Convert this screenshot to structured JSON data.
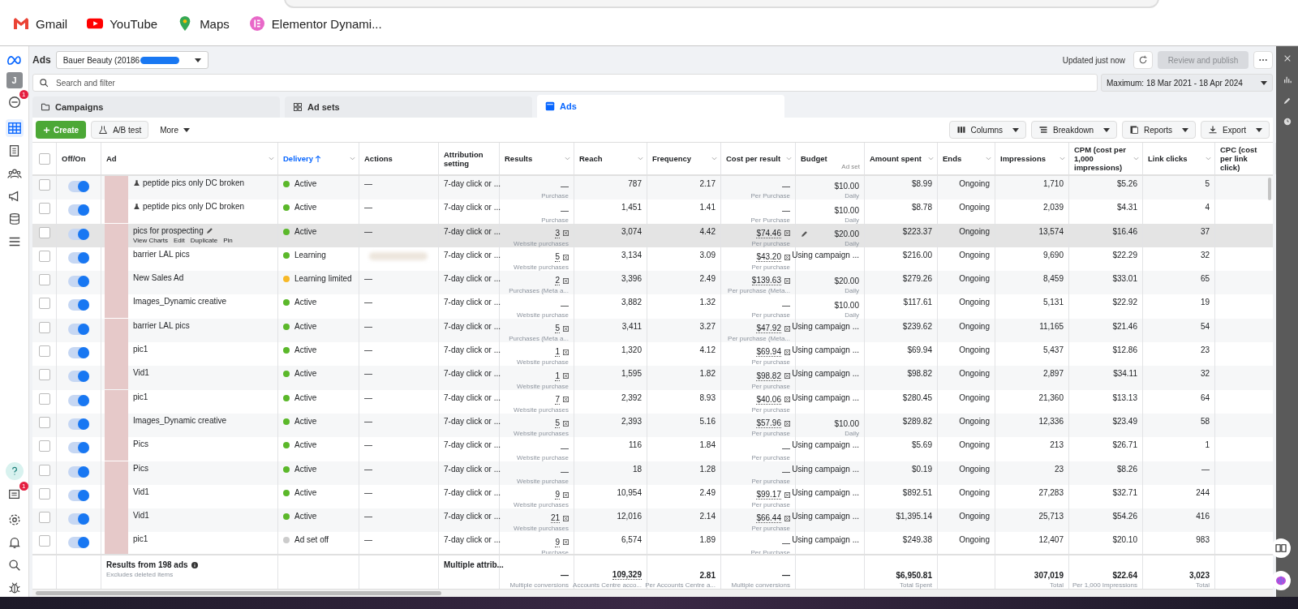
{
  "bookmarks": [
    {
      "label": "Gmail",
      "kind": "gmail"
    },
    {
      "label": "YouTube",
      "kind": "youtube"
    },
    {
      "label": "Maps",
      "kind": "maps"
    },
    {
      "label": "Elementor Dynami...",
      "kind": "elementor"
    }
  ],
  "left_nav": {
    "avatar": "J",
    "top_badge": "1",
    "bottom_badge": "1"
  },
  "header": {
    "title": "Ads",
    "account": "Bauer Beauty (20186",
    "updated": "Updated just now",
    "publish": "Review and publish"
  },
  "search": {
    "placeholder": "Search and filter"
  },
  "date_range": "Maximum: 18 Mar 2021 - 18 Apr 2024",
  "tabs": [
    {
      "label": "Campaigns",
      "kind": "folder",
      "selected": false
    },
    {
      "label": "Ad sets",
      "kind": "grid",
      "selected": false
    },
    {
      "label": "Ads",
      "kind": "ads",
      "selected": true
    }
  ],
  "toolbar": {
    "create": "Create",
    "ab_test": "A/B test",
    "more": "More",
    "right": [
      {
        "label": "Columns",
        "kind": "columns"
      },
      {
        "label": "Breakdown",
        "kind": "breakdown"
      },
      {
        "label": "Reports",
        "kind": "reports"
      },
      {
        "label": "Export",
        "kind": "export"
      }
    ]
  },
  "select_all": {
    "checked": false
  },
  "columns": [
    {
      "label": "Off/On",
      "sorted": false
    },
    {
      "label": "Ad",
      "menu": true,
      "sorted": false
    },
    {
      "label": "Delivery",
      "menu": true,
      "sorted": true
    },
    {
      "label": "Actions",
      "sorted": false
    },
    {
      "label": "Attribution setting",
      "sorted": false
    },
    {
      "label": "Results",
      "menu": true,
      "sorted": false
    },
    {
      "label": "Reach",
      "menu": true,
      "sorted": false
    },
    {
      "label": "Frequency",
      "menu": true,
      "sorted": false
    },
    {
      "label": "Cost per result",
      "menu": true,
      "sorted": false
    },
    {
      "label": "Budget",
      "sub": "Ad set",
      "sorted": false
    },
    {
      "label": "Amount spent",
      "menu": true,
      "sorted": false
    },
    {
      "label": "Ends",
      "menu": true,
      "sorted": false
    },
    {
      "label": "Impressions",
      "menu": true,
      "sorted": false
    },
    {
      "label": "CPM (cost per 1,000 impressions)",
      "menu": true,
      "sorted": false
    },
    {
      "label": "Link clicks",
      "menu": true,
      "sorted": false
    },
    {
      "label": "CPC (cost per link click)",
      "sorted": false
    }
  ],
  "rows": [
    {
      "checked": false,
      "on": true,
      "name": "peptide pics only DC broken",
      "ab_test": true,
      "highlighted": false,
      "delivery": "Active",
      "color": "#5bb82a",
      "actions": "—",
      "attribution": "7-day click or ...",
      "results": {
        "value": "—",
        "sub": "Purchase",
        "dotted": false
      },
      "reach": "787",
      "frequency": "2.17",
      "cost": {
        "value": "—",
        "sub": "Per Purchase",
        "dotted": false
      },
      "budget": {
        "value": "$10.00",
        "sub": "Daily"
      },
      "spent": "$8.99",
      "ends": "Ongoing",
      "impressions": "1,710",
      "cpm": "$5.26",
      "clicks": "5"
    },
    {
      "checked": false,
      "on": true,
      "name": "peptide pics only DC broken",
      "ab_test": true,
      "highlighted": false,
      "delivery": "Active",
      "color": "#5bb82a",
      "actions": "—",
      "attribution": "7-day click or ...",
      "results": {
        "value": "—",
        "sub": "Purchase",
        "dotted": false
      },
      "reach": "1,451",
      "frequency": "1.41",
      "cost": {
        "value": "—",
        "sub": "Per Purchase",
        "dotted": false
      },
      "budget": {
        "value": "$10.00",
        "sub": "Daily"
      },
      "spent": "$8.78",
      "ends": "Ongoing",
      "impressions": "2,039",
      "cpm": "$4.31",
      "clicks": "4"
    },
    {
      "checked": false,
      "on": true,
      "name": "pics for prospecting",
      "ab_test": false,
      "highlighted": true,
      "row_actions": [
        "View Charts",
        "Edit",
        "Duplicate",
        "Pin"
      ],
      "delivery": "Active",
      "color": "#5bb82a",
      "actions": "—",
      "attribution": "7-day click or ...",
      "results": {
        "value": "3",
        "sub": "Website purchases",
        "dotted": true
      },
      "reach": "3,074",
      "frequency": "4.42",
      "cost": {
        "value": "$74.46",
        "sub": "Per purchase",
        "dotted": true
      },
      "budget": {
        "value": "$20.00",
        "sub": "Daily"
      },
      "spent": "$223.37",
      "ends": "Ongoing",
      "impressions": "13,574",
      "cpm": "$16.46",
      "clicks": "37"
    },
    {
      "checked": false,
      "on": true,
      "name": "barrier LAL pics",
      "ab_test": false,
      "highlighted": false,
      "delivery": "Learning",
      "color": "#5bb82a",
      "attribution": "7-day click or ...",
      "results": {
        "value": "5",
        "sub": "Website purchases",
        "dotted": true
      },
      "reach": "3,134",
      "frequency": "3.09",
      "cost": {
        "value": "$43.20",
        "sub": "Per purchase",
        "dotted": true
      },
      "budget": {
        "value": "Using campaign ..."
      },
      "spent": "$216.00",
      "ends": "Ongoing",
      "impressions": "9,690",
      "cpm": "$22.29",
      "clicks": "32"
    },
    {
      "checked": false,
      "on": true,
      "name": "New Sales Ad",
      "ab_test": false,
      "highlighted": false,
      "delivery": "Learning limited",
      "color": "#f7b928",
      "actions": "—",
      "attribution": "7-day click or ...",
      "results": {
        "value": "2",
        "sub": "Purchases (Meta a...",
        "dotted": true
      },
      "reach": "3,396",
      "frequency": "2.49",
      "cost": {
        "value": "$139.63",
        "sub": "Per purchase (Meta...",
        "dotted": true
      },
      "budget": {
        "value": "$20.00",
        "sub": "Daily"
      },
      "spent": "$279.26",
      "ends": "Ongoing",
      "impressions": "8,459",
      "cpm": "$33.01",
      "clicks": "65"
    },
    {
      "checked": false,
      "on": true,
      "name": "Images_Dynamic creative",
      "ab_test": false,
      "highlighted": false,
      "delivery": "Active",
      "color": "#5bb82a",
      "actions": "—",
      "attribution": "7-day click or ...",
      "results": {
        "value": "—",
        "sub": "Website purchase",
        "dotted": false
      },
      "reach": "3,882",
      "frequency": "1.32",
      "cost": {
        "value": "—",
        "sub": "Per purchase",
        "dotted": false
      },
      "budget": {
        "value": "$10.00",
        "sub": "Daily"
      },
      "spent": "$117.61",
      "ends": "Ongoing",
      "impressions": "5,131",
      "cpm": "$22.92",
      "clicks": "19"
    },
    {
      "checked": false,
      "on": true,
      "name": "barrier LAL pics",
      "ab_test": false,
      "highlighted": false,
      "delivery": "Active",
      "color": "#5bb82a",
      "actions": "—",
      "attribution": "7-day click or ...",
      "results": {
        "value": "5",
        "sub": "Purchases (Meta a...",
        "dotted": true
      },
      "reach": "3,411",
      "frequency": "3.27",
      "cost": {
        "value": "$47.92",
        "sub": "Per purchase (Meta...",
        "dotted": true
      },
      "budget": {
        "value": "Using campaign ..."
      },
      "spent": "$239.62",
      "ends": "Ongoing",
      "impressions": "11,165",
      "cpm": "$21.46",
      "clicks": "54"
    },
    {
      "checked": false,
      "on": true,
      "name": "pic1",
      "ab_test": false,
      "highlighted": false,
      "delivery": "Active",
      "color": "#5bb82a",
      "actions": "—",
      "attribution": "7-day click or ...",
      "results": {
        "value": "1",
        "sub": "Website purchase",
        "dotted": true
      },
      "reach": "1,320",
      "frequency": "4.12",
      "cost": {
        "value": "$69.94",
        "sub": "Per purchase",
        "dotted": true
      },
      "budget": {
        "value": "Using campaign ..."
      },
      "spent": "$69.94",
      "ends": "Ongoing",
      "impressions": "5,437",
      "cpm": "$12.86",
      "clicks": "23"
    },
    {
      "checked": false,
      "on": true,
      "name": "Vid1",
      "ab_test": false,
      "highlighted": false,
      "delivery": "Active",
      "color": "#5bb82a",
      "actions": "—",
      "attribution": "7-day click or ...",
      "results": {
        "value": "1",
        "sub": "Website purchase",
        "dotted": true
      },
      "reach": "1,595",
      "frequency": "1.82",
      "cost": {
        "value": "$98.82",
        "sub": "Per purchase",
        "dotted": true
      },
      "budget": {
        "value": "Using campaign ..."
      },
      "spent": "$98.82",
      "ends": "Ongoing",
      "impressions": "2,897",
      "cpm": "$34.11",
      "clicks": "32"
    },
    {
      "checked": false,
      "on": true,
      "name": "pic1",
      "ab_test": false,
      "highlighted": false,
      "delivery": "Active",
      "color": "#5bb82a",
      "actions": "—",
      "attribution": "7-day click or ...",
      "results": {
        "value": "7",
        "sub": "Website purchases",
        "dotted": true
      },
      "reach": "2,392",
      "frequency": "8.93",
      "cost": {
        "value": "$40.06",
        "sub": "Per purchase",
        "dotted": true
      },
      "budget": {
        "value": "Using campaign ..."
      },
      "spent": "$280.45",
      "ends": "Ongoing",
      "impressions": "21,360",
      "cpm": "$13.13",
      "clicks": "64"
    },
    {
      "checked": false,
      "on": true,
      "name": "Images_Dynamic creative",
      "ab_test": false,
      "highlighted": false,
      "delivery": "Active",
      "color": "#5bb82a",
      "actions": "—",
      "attribution": "7-day click or ...",
      "results": {
        "value": "5",
        "sub": "Website purchases",
        "dotted": true
      },
      "reach": "2,393",
      "frequency": "5.16",
      "cost": {
        "value": "$57.96",
        "sub": "Per purchase",
        "dotted": true
      },
      "budget": {
        "value": "$10.00",
        "sub": "Daily"
      },
      "spent": "$289.82",
      "ends": "Ongoing",
      "impressions": "12,336",
      "cpm": "$23.49",
      "clicks": "58"
    },
    {
      "checked": false,
      "on": true,
      "name": "Pics",
      "ab_test": false,
      "highlighted": false,
      "delivery": "Active",
      "color": "#5bb82a",
      "actions": "—",
      "attribution": "7-day click or ...",
      "results": {
        "value": "—",
        "sub": "Website purchase",
        "dotted": false
      },
      "reach": "116",
      "frequency": "1.84",
      "cost": {
        "value": "—",
        "sub": "Per purchase",
        "dotted": false
      },
      "budget": {
        "value": "Using campaign ..."
      },
      "spent": "$5.69",
      "ends": "Ongoing",
      "impressions": "213",
      "cpm": "$26.71",
      "clicks": "1"
    },
    {
      "checked": false,
      "on": true,
      "name": "Pics",
      "ab_test": false,
      "highlighted": false,
      "delivery": "Active",
      "color": "#5bb82a",
      "actions": "—",
      "attribution": "7-day click or ...",
      "results": {
        "value": "—",
        "sub": "Website purchase",
        "dotted": false
      },
      "reach": "18",
      "frequency": "1.28",
      "cost": {
        "value": "—",
        "sub": "Per purchase",
        "dotted": false
      },
      "budget": {
        "value": "Using campaign ..."
      },
      "spent": "$0.19",
      "ends": "Ongoing",
      "impressions": "23",
      "cpm": "$8.26",
      "clicks": "—"
    },
    {
      "checked": false,
      "on": true,
      "name": "Vid1",
      "ab_test": false,
      "highlighted": false,
      "delivery": "Active",
      "color": "#5bb82a",
      "actions": "—",
      "attribution": "7-day click or ...",
      "results": {
        "value": "9",
        "sub": "Website purchases",
        "dotted": true
      },
      "reach": "10,954",
      "frequency": "2.49",
      "cost": {
        "value": "$99.17",
        "sub": "Per purchase",
        "dotted": true
      },
      "budget": {
        "value": "Using campaign ..."
      },
      "spent": "$892.51",
      "ends": "Ongoing",
      "impressions": "27,283",
      "cpm": "$32.71",
      "clicks": "244"
    },
    {
      "checked": false,
      "on": true,
      "name": "Vid1",
      "ab_test": false,
      "highlighted": false,
      "delivery": "Active",
      "color": "#5bb82a",
      "actions": "—",
      "attribution": "7-day click or ...",
      "results": {
        "value": "21",
        "sub": "Website purchases",
        "dotted": true
      },
      "reach": "12,016",
      "frequency": "2.14",
      "cost": {
        "value": "$66.44",
        "sub": "Per purchase",
        "dotted": true
      },
      "budget": {
        "value": "Using campaign ..."
      },
      "spent": "$1,395.14",
      "ends": "Ongoing",
      "impressions": "25,713",
      "cpm": "$54.26",
      "clicks": "416"
    },
    {
      "checked": false,
      "on": true,
      "name": "pic1",
      "ab_test": false,
      "highlighted": false,
      "delivery": "Ad set off",
      "color": "#cccccc",
      "actions": "—",
      "attribution": "7-day click or ...",
      "results": {
        "value": "9",
        "sub": "Purchase",
        "dotted": true
      },
      "reach": "6,574",
      "frequency": "1.89",
      "cost": {
        "value": "—",
        "sub": "Per Purchase",
        "dotted": false
      },
      "budget": {
        "value": "Using campaign ..."
      },
      "spent": "$249.38",
      "ends": "Ongoing",
      "impressions": "12,407",
      "cpm": "$20.10",
      "clicks": "983"
    }
  ],
  "totals": {
    "label": "Results from 198 ads",
    "note": "Excludes deleted items",
    "attribution": "Multiple attrib...",
    "results": {
      "value": "—",
      "sub": "Multiple conversions"
    },
    "reach": {
      "value": "109,329",
      "sub": "Accounts Centre acco..."
    },
    "frequency": {
      "value": "2.81",
      "sub": "Per Accounts Centre a..."
    },
    "cost": {
      "value": "—",
      "sub": "Multiple conversions"
    },
    "spent": {
      "value": "$6,950.81",
      "sub": "Total Spent"
    },
    "impressions": {
      "value": "307,019",
      "sub": "Total"
    },
    "cpm": {
      "value": "$22.64",
      "sub": "Per 1,000 Impressions"
    },
    "clicks": {
      "value": "3,023",
      "sub": "Total"
    }
  }
}
